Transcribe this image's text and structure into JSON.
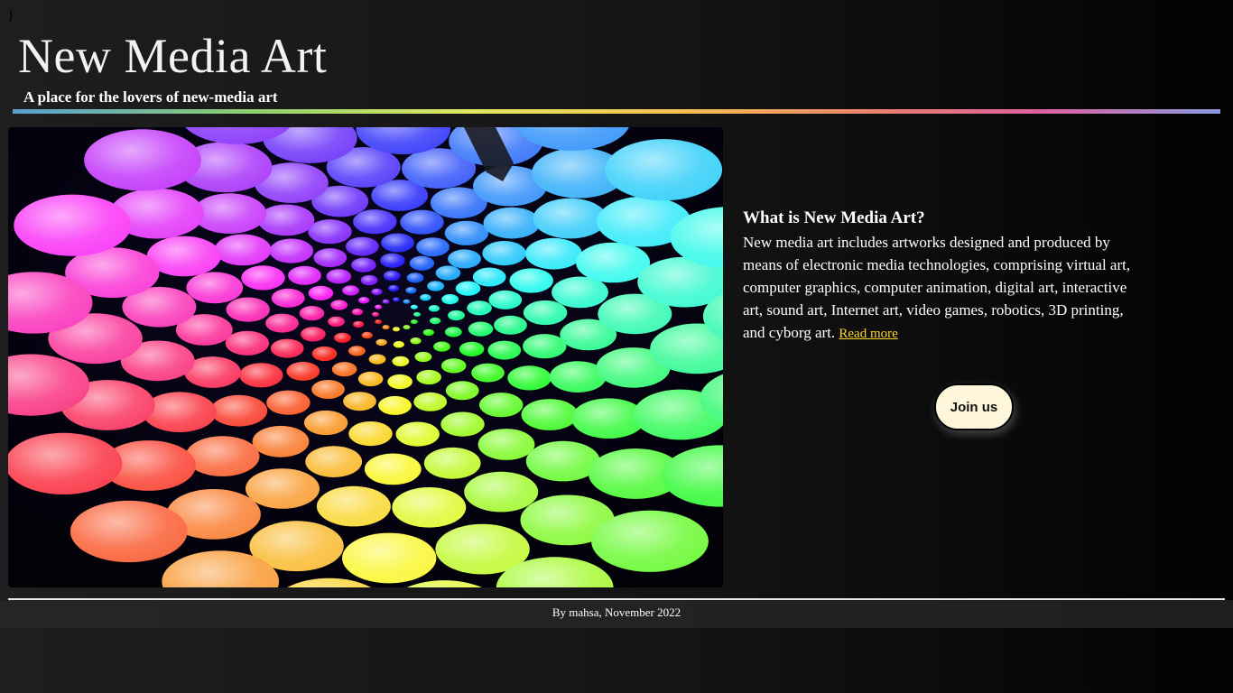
{
  "stray_text": "}",
  "header": {
    "title": "New Media Art",
    "tagline": "A place for the lovers of new-media art"
  },
  "hero": {
    "image_label": "New media art installation"
  },
  "about": {
    "heading": "What is New Media Art?",
    "body": "New media art includes artworks designed and produced by means of electronic media technologies, comprising virtual art, computer graphics, computer animation, digital art, interactive art, sound art, Internet art, video games, robotics, 3D printing, and cyborg art.",
    "read_more_label": "Read more"
  },
  "cta": {
    "join_label": "Join us"
  },
  "footer": {
    "credit": "By mahsa, November 2022"
  },
  "colors": {
    "read_more": "#ffd42a",
    "button_bg": "#fff6dc",
    "background_left": "#1e1e1e",
    "background_right": "#020202"
  }
}
